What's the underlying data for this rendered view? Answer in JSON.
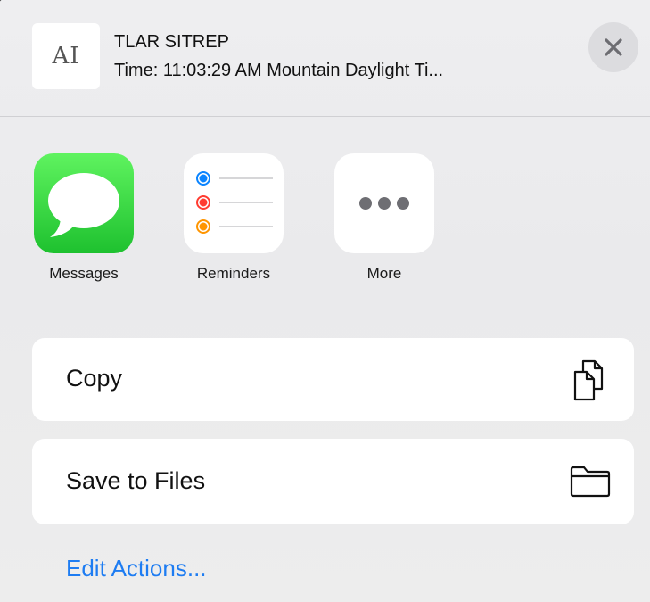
{
  "header": {
    "doc_glyph": "AI",
    "title": "TLAR SITREP",
    "subtitle": "Time: 11:03:29 AM Mountain Daylight Ti..."
  },
  "apps": [
    {
      "label": "Messages",
      "icon": "messages-icon"
    },
    {
      "label": "Reminders",
      "icon": "reminders-icon"
    },
    {
      "label": "More",
      "icon": "more-icon"
    }
  ],
  "actions": [
    {
      "label": "Copy",
      "icon": "copy-icon"
    },
    {
      "label": "Save to Files",
      "icon": "folder-icon"
    }
  ],
  "edit_actions_label": "Edit Actions...",
  "colors": {
    "accent": "#1d7cf2",
    "messages_green": "#2bcb3b",
    "reminder_blue": "#0a84ff",
    "reminder_red": "#ff3b30",
    "reminder_orange": "#ff9500"
  }
}
